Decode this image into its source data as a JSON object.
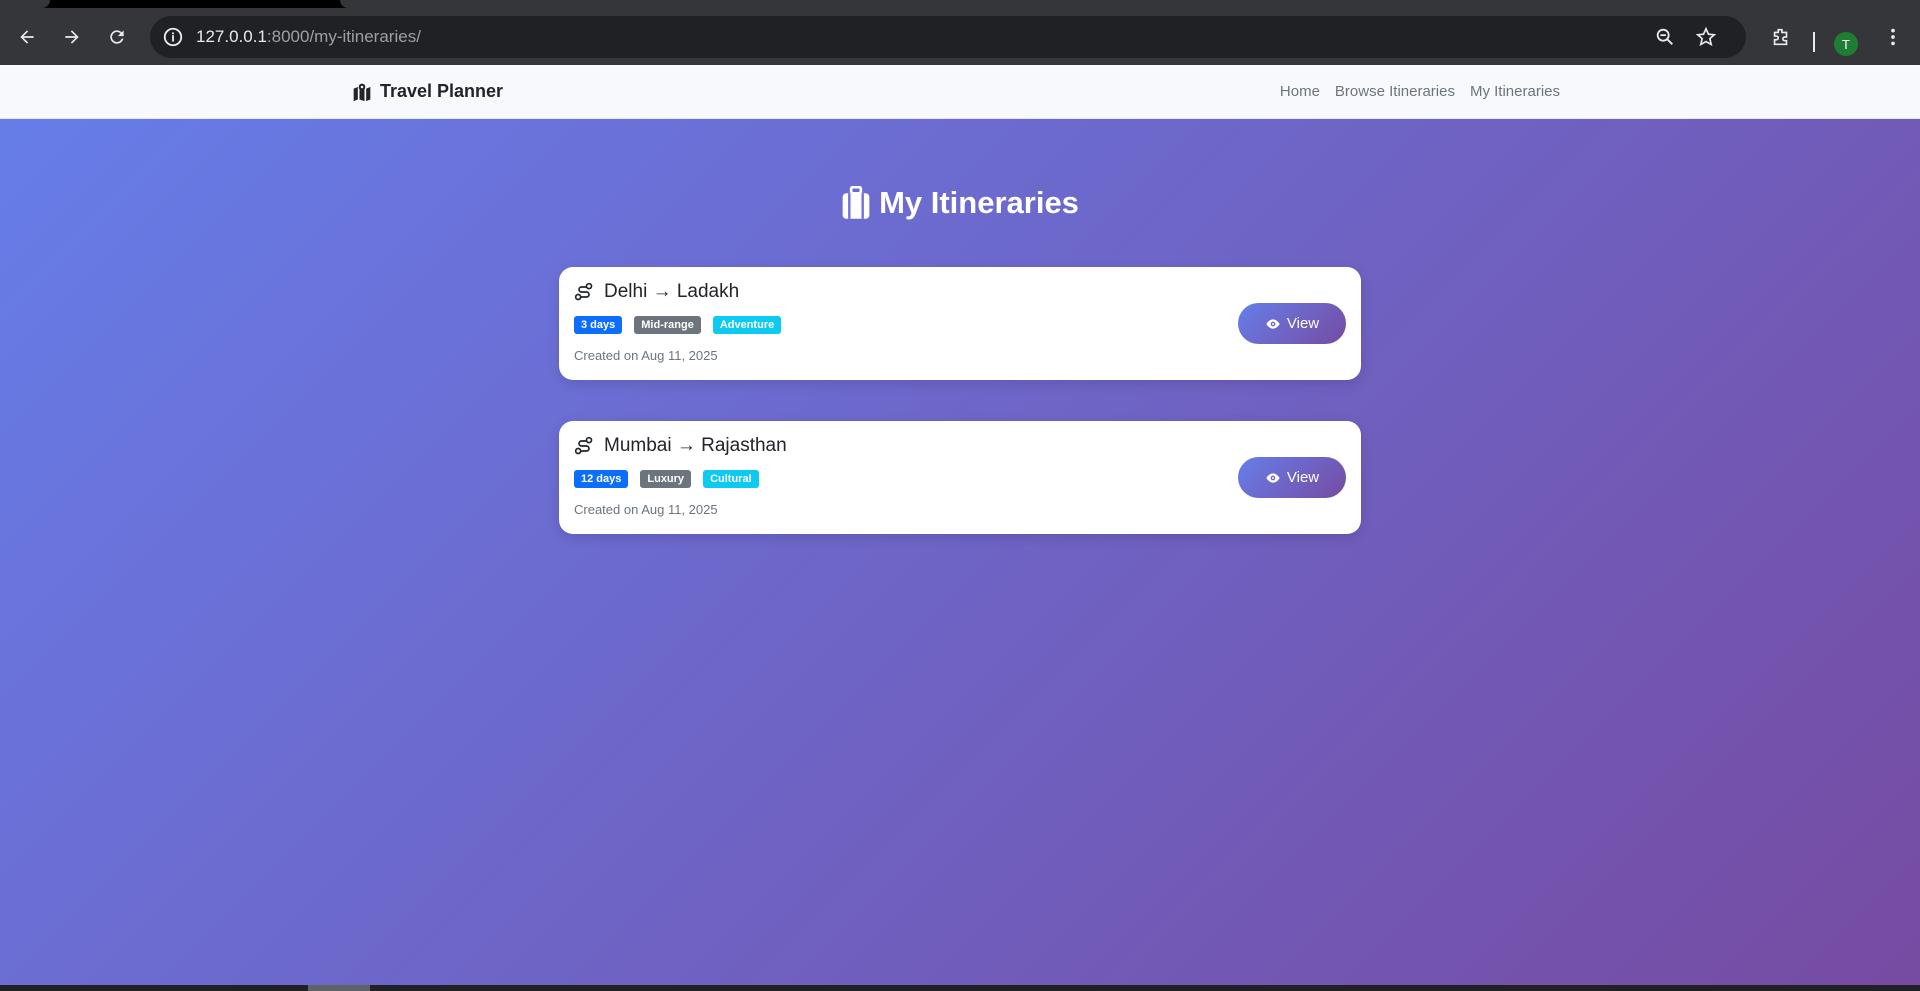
{
  "browser": {
    "url_host": "127.0.0.1",
    "url_rest": ":8000/my-itineraries/",
    "profile_initial": "T"
  },
  "navbar": {
    "brand": "Travel Planner",
    "links": [
      "Home",
      "Browse Itineraries",
      "My Itineraries"
    ]
  },
  "main": {
    "title": "My Itineraries",
    "itineraries": [
      {
        "route": "Delhi → Ladakh",
        "badges": [
          "3 days",
          "Mid-range",
          "Adventure"
        ],
        "created": "Created on Aug 11, 2025",
        "button": "View"
      },
      {
        "route": "Mumbai → Rajasthan",
        "badges": [
          "12 days",
          "Luxury",
          "Cultural"
        ],
        "created": "Created on Aug 11, 2025",
        "button": "View"
      }
    ]
  },
  "colors": {
    "gradient_start": "#667eea",
    "gradient_end": "#764ba2",
    "badge_primary": "#0d6efd",
    "badge_secondary": "#6c757d",
    "badge_info": "#0dcaf0"
  },
  "icons": {
    "brand": "map-marked-icon",
    "heading": "suitcase-icon",
    "route": "route-icon",
    "view": "eye-icon"
  }
}
